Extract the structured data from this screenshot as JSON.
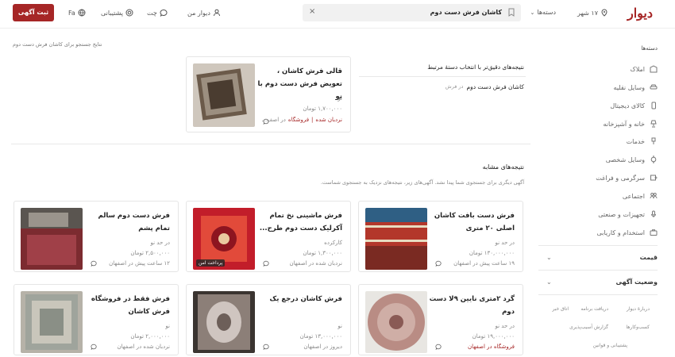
{
  "header": {
    "logo": "دیوار",
    "city": "۱۷ شهر",
    "categories": "دسته‌ها",
    "search_text": "کاشان فرش دست دوم",
    "my_divar": "دیوار من",
    "chat": "چت",
    "support": "پشتیبانی",
    "lang": "Fa",
    "post_button": "ثبت آگهی"
  },
  "results_caption": "نتایج جستجو برای کاشان فرش دست دوم",
  "related": {
    "heading": "نتیجه‌های دقیق‌تر با انتخاب دستهٔ مرتبط",
    "item": "کاشان فرش دست دوم",
    "item_cat": "در فرش"
  },
  "featured": {
    "title": "قالی فرش کاشان ، تعویض فرش دست دوم با نو",
    "condition": "نو",
    "price": "۱,۷۰۰,۰۰۰ تومان",
    "ladder": "نردبان شده",
    "sep": "|",
    "shop": "فروشگاه",
    "loc": "در اصف..."
  },
  "similar": {
    "heading": "نتیجه‌های مشابه",
    "subtext": "آگهی دیگری برای جستجوی شما پیدا نشد. آگهی‌های زیر، نتیجه‌های نزدیک به جستجوی شماست."
  },
  "cards": [
    {
      "title": "فرش دست بافت کاشان اصلی ۲۰ متری",
      "l1": "در حد نو",
      "l2": "۱۳۰,۰۰۰,۰۰۰ تومان",
      "l3": "۱۹ ساعت پیش در اصفهان",
      "badge": ""
    },
    {
      "title": "فرش ماشینی نخ تمام آکرلیک دست دوم طرح...",
      "l1": "کارکرده",
      "l2": "۱,۳۰۰,۰۰۰ تومان",
      "l3": "نردبان شده در اصفهان",
      "badge": "پرداخت امن"
    },
    {
      "title": "فرش دست دوم سالم تمام پشم",
      "l1": "در حد نو",
      "l2": "۲,۵۰۰,۰۰۰ تومان",
      "l3": "۱۲ ساعت پیش در اصفهان",
      "badge": ""
    },
    {
      "title": "گرد ۲متری نایین ۹لا دست دوم",
      "l1": "در حد نو",
      "l2": "۱۹,۰۰۰,۰۰۰ تومان",
      "l3": "فروشگاه در اصفهان",
      "badge": ""
    },
    {
      "title": "فرش کاشان درجع یک",
      "l1": "نو",
      "l2": "۱۳,۰۰۰,۰۰۰ تومان",
      "l3": "دیروز در اصفهان",
      "badge": ""
    },
    {
      "title": "فرش فقط در فروشگاه فرش کاشان",
      "l1": "نو",
      "l2": "۲,۰۰۰,۰۰۰ تومان",
      "l3": "نردبان شده در اصفهان",
      "badge": ""
    }
  ],
  "sidebar": {
    "heading": "دسته‌ها",
    "items": [
      "املاک",
      "وسایل نقلیه",
      "کالای دیجیتال",
      "خانه و آشپزخانه",
      "خدمات",
      "وسایل شخصی",
      "سرگرمی و فراغت",
      "اجتماعی",
      "تجهیزات و صنعتی",
      "استخدام و کاریابی"
    ],
    "filter_price": "قیمت",
    "filter_status": "وضعیت آگهی",
    "footer": [
      "دربارهٔ دیوار",
      "دریافت برنامه",
      "اتاق خبر",
      "کسب‌وکارها",
      "گزارش آسیب‌پذیری",
      "پشتیبانی و قوانین"
    ]
  },
  "colors": {
    "brand": "#a62626"
  }
}
